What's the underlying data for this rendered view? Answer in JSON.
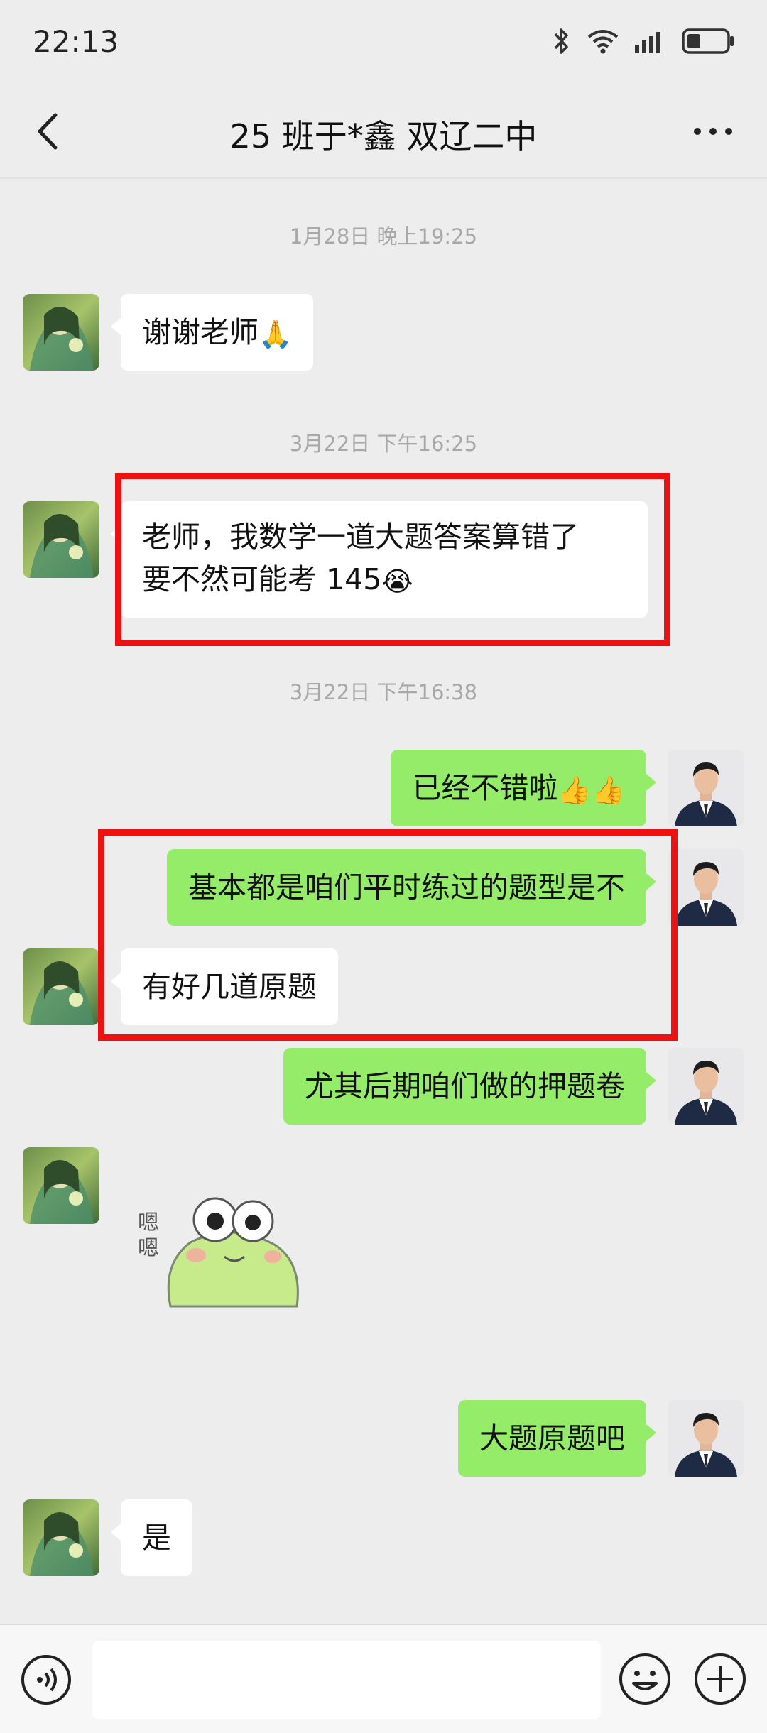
{
  "status_bar": {
    "time": "22:13",
    "icons": [
      "bluetooth-icon",
      "wifi-icon",
      "signal-icon",
      "battery-icon"
    ]
  },
  "header": {
    "title": "25 班于*鑫 双辽二中",
    "back_icon": "back-chevron-icon",
    "more_icon": "more-dots-icon"
  },
  "timestamps": [
    "1月28日 晚上19:25",
    "3月22日 下午16:25",
    "3月22日 下午16:38"
  ],
  "messages": [
    {
      "side": "in",
      "text": "谢谢老师",
      "emoji": "🙏"
    },
    {
      "side": "in",
      "lines": [
        "老师，我数学一道大题答案算错了",
        "要不然可能考 145"
      ],
      "emoji": "😭"
    },
    {
      "side": "out",
      "text": "已经不错啦",
      "emoji": "👍👍"
    },
    {
      "side": "out",
      "text": "基本都是咱们平时练过的题型是不"
    },
    {
      "side": "in",
      "text": "有好几道原题"
    },
    {
      "side": "out",
      "text": "尤其后期咱们做的押题卷"
    },
    {
      "side": "in",
      "sticker": "frog-sticker",
      "sticker_text": "嗯嗯"
    },
    {
      "side": "out",
      "text": "大题原题吧"
    },
    {
      "side": "in",
      "text": "是"
    }
  ],
  "colors": {
    "outgoing_bubble": "#95ec69",
    "incoming_bubble": "#ffffff",
    "highlight_box": "#ee1111",
    "background": "#ededed"
  },
  "bottom_bar": {
    "voice_icon": "voice-icon",
    "emoji_icon": "emoji-icon",
    "plus_icon": "plus-icon",
    "input_value": ""
  }
}
